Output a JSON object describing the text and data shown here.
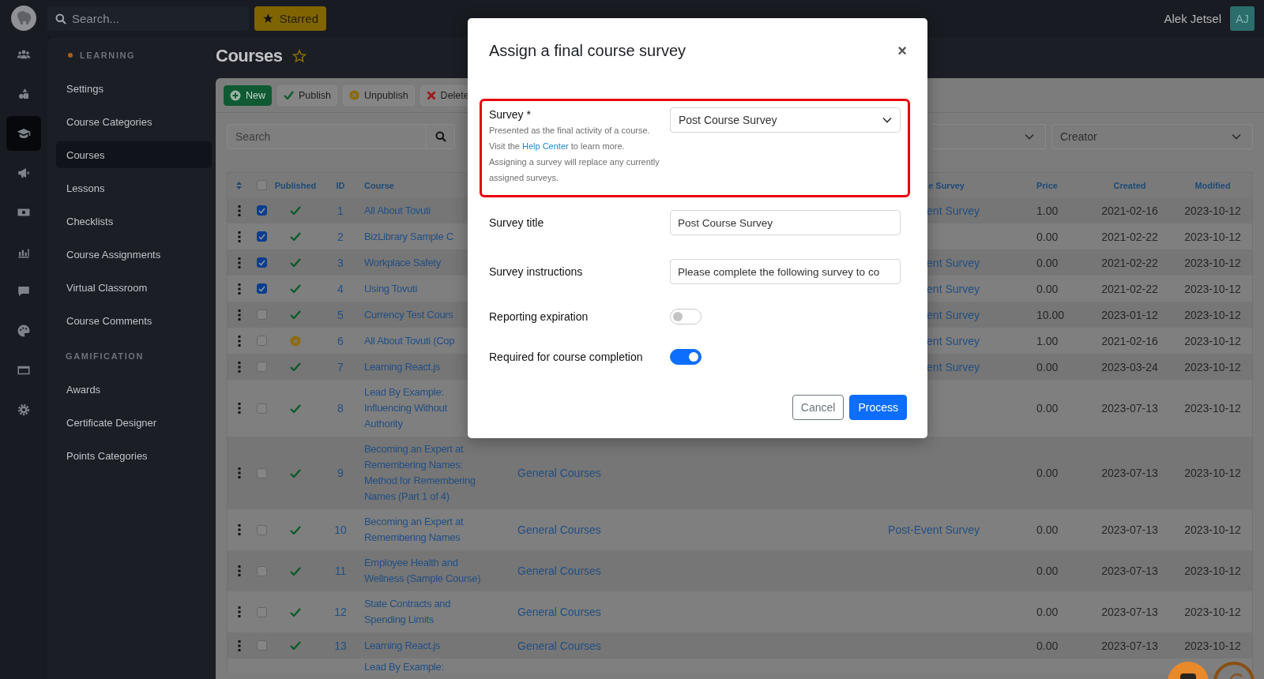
{
  "topbar": {
    "search_placeholder": "Search...",
    "starred_label": "Starred",
    "user_name": "Alek Jetsel",
    "avatar_initials": "AJ"
  },
  "rail": [
    {
      "selected": false
    },
    {
      "selected": false
    },
    {
      "selected": true
    },
    {
      "selected": false
    },
    {
      "selected": false
    },
    {
      "selected": false
    },
    {
      "selected": false
    },
    {
      "selected": false
    },
    {
      "selected": false
    },
    {
      "selected": false
    }
  ],
  "sidebar": {
    "sections": [
      {
        "title": "LEARNING",
        "active": true,
        "items": [
          {
            "label": "Settings",
            "selected": false
          },
          {
            "label": "Course Categories",
            "selected": false
          },
          {
            "label": "Courses",
            "selected": true
          },
          {
            "label": "Lessons",
            "selected": false
          },
          {
            "label": "Checklists",
            "selected": false
          },
          {
            "label": "Course Assignments",
            "selected": false
          },
          {
            "label": "Virtual Classroom",
            "selected": false
          },
          {
            "label": "Course Comments",
            "selected": false
          }
        ]
      },
      {
        "title": "GAMIFICATION",
        "active": false,
        "items": [
          {
            "label": "Awards",
            "selected": false
          },
          {
            "label": "Certificate Designer",
            "selected": false
          },
          {
            "label": "Points Categories",
            "selected": false
          }
        ]
      }
    ]
  },
  "page": {
    "title": "Courses",
    "starred": false
  },
  "toolbar": [
    {
      "label": "New",
      "kind": "new"
    },
    {
      "label": "Publish",
      "kind": "publish"
    },
    {
      "label": "Unpublish",
      "kind": "unpublish"
    },
    {
      "label": "Delete",
      "kind": "delete"
    }
  ],
  "filters": {
    "search_placeholder": "Search",
    "creator_placeholder": "Creator"
  },
  "table": {
    "header_checked": false,
    "columns": {
      "published": "Published",
      "id": "ID",
      "course": "Course",
      "survey": "e Survey",
      "price": "Price",
      "created": "Created",
      "modified": "Modified"
    },
    "rows": [
      {
        "checked": true,
        "published": true,
        "id": "1",
        "course": "All About Tovuti",
        "survey": "ent Survey",
        "price": "1.00",
        "created": "2021-02-16",
        "modified": "2023-10-12"
      },
      {
        "checked": true,
        "published": true,
        "id": "2",
        "course": "BizLibrary Sample C",
        "price": "0.00",
        "created": "2021-02-22",
        "modified": "2023-10-12"
      },
      {
        "checked": true,
        "published": true,
        "id": "3",
        "course": "Workplace Safety",
        "survey": "ent Survey",
        "price": "0.00",
        "created": "2021-02-22",
        "modified": "2023-10-12"
      },
      {
        "checked": true,
        "published": true,
        "id": "4",
        "course": "Using Tovuti",
        "survey": "ent Survey",
        "price": "0.00",
        "created": "2021-02-22",
        "modified": "2023-10-12"
      },
      {
        "checked": false,
        "published": true,
        "id": "5",
        "course": "Currency Test Cours",
        "survey": "ent Survey",
        "price": "10.00",
        "created": "2023-01-12",
        "modified": "2023-10-12"
      },
      {
        "checked": false,
        "published": false,
        "id": "6",
        "course": "All About Tovuti (Cop",
        "survey": "ent Survey",
        "price": "1.00",
        "created": "2021-02-16",
        "modified": "2023-10-12"
      },
      {
        "checked": false,
        "published": true,
        "id": "7",
        "course": "Learning React.js",
        "survey": "ent Survey",
        "price": "0.00",
        "created": "2023-03-24",
        "modified": "2023-10-12"
      },
      {
        "checked": false,
        "published": true,
        "id": "8",
        "course": "Lead By Example: Influencing Without Authority",
        "price": "0.00",
        "created": "2023-07-13",
        "modified": "2023-10-12"
      },
      {
        "checked": false,
        "published": true,
        "id": "9",
        "course": "Becoming an Expert at Remembering Names: Method for Remembering Names (Part 1 of 4)",
        "category": "General Courses",
        "price": "0.00",
        "created": "2023-07-13",
        "modified": "2023-10-12"
      },
      {
        "checked": false,
        "published": true,
        "id": "10",
        "course": "Becoming an Expert at Remembering Names",
        "category": "General Courses",
        "survey": "Post-Event Survey",
        "price": "0.00",
        "created": "2023-07-13",
        "modified": "2023-10-12"
      },
      {
        "checked": false,
        "published": true,
        "id": "11",
        "course": "Employee Health and Wellness (Sample Course)",
        "category": "General Courses",
        "price": "0.00",
        "created": "2023-07-13",
        "modified": "2023-10-12"
      },
      {
        "checked": false,
        "published": true,
        "id": "12",
        "course": "State Contracts and Spending Limits",
        "category": "General Courses",
        "price": "0.00",
        "created": "2023-07-13",
        "modified": "2023-10-12"
      },
      {
        "checked": false,
        "published": true,
        "id": "13",
        "course": "Learning React.js",
        "category": "General Courses",
        "price": "0.00",
        "created": "2023-07-13",
        "modified": "2023-10-12"
      }
    ],
    "partial_row": {
      "course": "Lead By Example:"
    }
  },
  "modal": {
    "title": "Assign a final course survey",
    "close": "×",
    "survey": {
      "label": "Survey *",
      "highlighted": true,
      "value": "Post Course Survey",
      "help": [
        {
          "kind": "text",
          "text": "Presented as the final activity of a course."
        },
        {
          "kind": "link",
          "before": "Visit the",
          "link": "Help Center",
          "after": "to learn more."
        },
        {
          "kind": "text",
          "text": "Assigning a survey will replace any currently assigned surveys."
        }
      ]
    },
    "fields": [
      {
        "kind": "input",
        "label": "Survey title",
        "value": "Post Course Survey"
      },
      {
        "kind": "input",
        "label": "Survey instructions",
        "value": "Please complete the following survey to co"
      },
      {
        "kind": "toggle",
        "label": "Reporting expiration",
        "on": false
      },
      {
        "kind": "toggle",
        "label": "Required for course completion",
        "on": true
      }
    ],
    "buttons": [
      {
        "label": "Cancel",
        "kind": "secondary"
      },
      {
        "label": "Process",
        "kind": "primary"
      }
    ]
  }
}
